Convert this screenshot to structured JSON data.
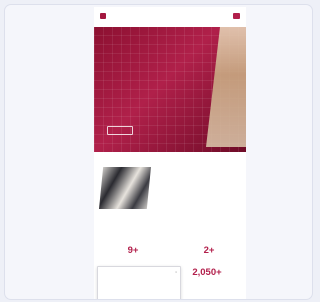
{
  "site": {
    "logo_text": "",
    "hero": {
      "title": "",
      "text": "",
      "button_label": ""
    },
    "overview": {
      "title": "",
      "subtitle": "",
      "list": [
        "",
        "",
        "",
        ""
      ]
    },
    "stats": {
      "title": "",
      "text": "",
      "items": [
        {
          "number": "9+",
          "label": ""
        },
        {
          "number": "2+",
          "label": ""
        },
        {
          "number": "2,050+",
          "label": ""
        }
      ]
    },
    "cookie_popup": {
      "title": "",
      "text": "",
      "buttons": [
        "",
        "",
        ""
      ]
    }
  },
  "colors": {
    "brand": "#a3173f",
    "background": "#eef0f7"
  }
}
